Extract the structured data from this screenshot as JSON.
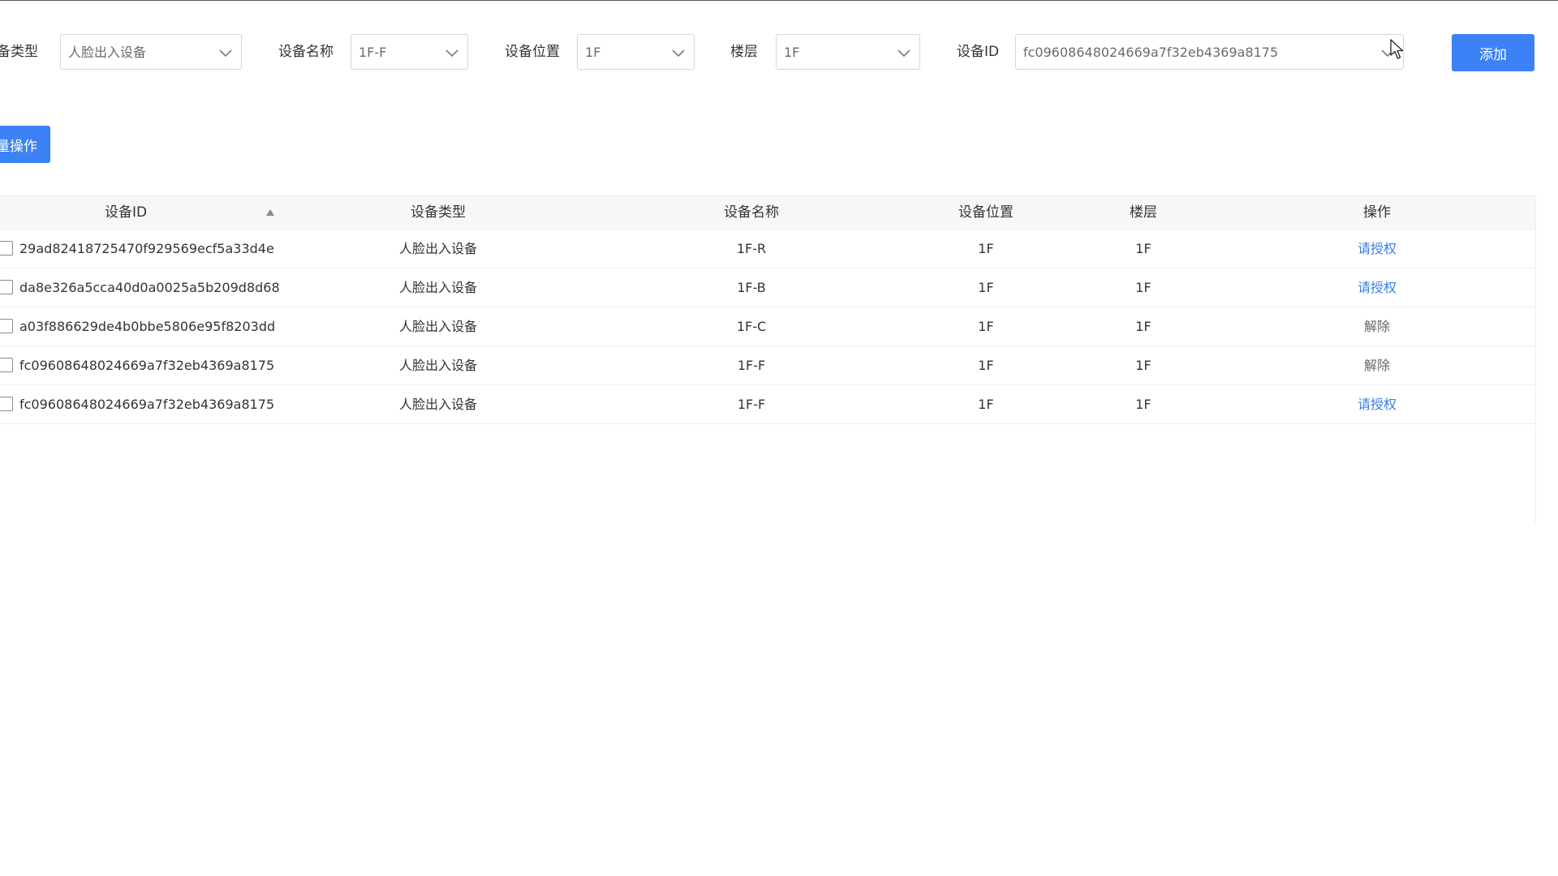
{
  "filters": {
    "device_type": {
      "label": "备类型",
      "value": "人脸出入设备"
    },
    "device_name": {
      "label": "设备名称",
      "value": "1F-F"
    },
    "device_location": {
      "label": "设备位置",
      "value": "1F"
    },
    "floor": {
      "label": "楼层",
      "value": "1F"
    },
    "device_id": {
      "label": "设备ID",
      "value": "fc09608648024669a7f32eb4369a8175"
    }
  },
  "buttons": {
    "add": "添加",
    "batch": "量操作"
  },
  "table": {
    "columns": [
      "设备ID",
      "设备类型",
      "设备名称",
      "设备位置",
      "楼层",
      "操作"
    ],
    "rows": [
      {
        "id": "29ad82418725470f929569ecf5a33d4e",
        "type": "人脸出入设备",
        "name": "1F-R",
        "location": "1F",
        "floor": "1F",
        "action": "请授权",
        "action_style": "link"
      },
      {
        "id": "da8e326a5cca40d0a0025a5b209d8d68",
        "type": "人脸出入设备",
        "name": "1F-B",
        "location": "1F",
        "floor": "1F",
        "action": "请授权",
        "action_style": "link"
      },
      {
        "id": "a03f886629de4b0bbe5806e95f8203dd",
        "type": "人脸出入设备",
        "name": "1F-C",
        "location": "1F",
        "floor": "1F",
        "action": "解除",
        "action_style": "muted"
      },
      {
        "id": "fc09608648024669a7f32eb4369a8175",
        "type": "人脸出入设备",
        "name": "1F-F",
        "location": "1F",
        "floor": "1F",
        "action": "解除",
        "action_style": "muted"
      },
      {
        "id": "fc09608648024669a7f32eb4369a8175",
        "type": "人脸出入设备",
        "name": "1F-F",
        "location": "1F",
        "floor": "1F",
        "action": "请授权",
        "action_style": "link"
      }
    ]
  },
  "icons": {
    "dropdown": "chevron-down-icon",
    "sort": "sort-ascending-icon",
    "cursor": "mouse-pointer-icon"
  },
  "colors": {
    "primary": "#3c82f6",
    "link": "#3c7be8",
    "header_bg": "#f6f7f9",
    "border": "#ebeef5"
  }
}
